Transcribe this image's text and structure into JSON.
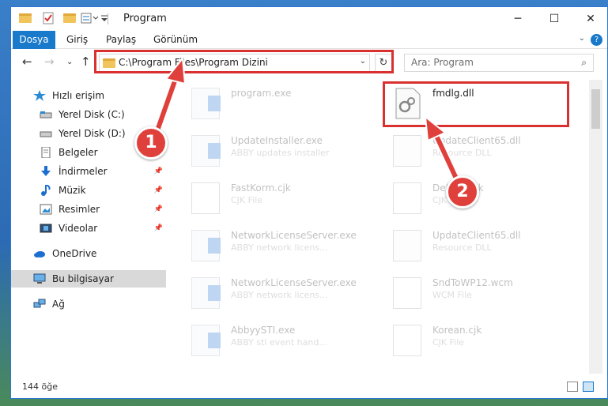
{
  "window": {
    "title": "Program",
    "minimize_label": "─",
    "maximize_label": "☐",
    "close_label": "✕"
  },
  "ribbon": {
    "tabs": [
      "Dosya",
      "Giriş",
      "Paylaş",
      "Görünüm"
    ],
    "help_label": "?",
    "expand_label": "⌄"
  },
  "navigation": {
    "back": "←",
    "forward": "→",
    "recent": "⌄",
    "up": "↑",
    "address": "C:\\Program Files\\Program Dizini",
    "address_dropdown": "⌄",
    "refresh": "↻",
    "search_placeholder": "Ara: Program",
    "search_icon": "⌕"
  },
  "sidebar": {
    "items": [
      {
        "label": "Hızlı erişim",
        "icon": "star-icon"
      },
      {
        "label": "Yerel Disk (C:)",
        "icon": "drive-icon"
      },
      {
        "label": "Yerel Disk (D:)",
        "icon": "drive-icon"
      },
      {
        "label": "Belgeler",
        "icon": "documents-icon"
      },
      {
        "label": "İndirmeler",
        "icon": "download-icon"
      },
      {
        "label": "Müzik",
        "icon": "music-icon"
      },
      {
        "label": "Resimler",
        "icon": "pictures-icon"
      },
      {
        "label": "Videolar",
        "icon": "videos-icon"
      },
      {
        "label": "OneDrive",
        "icon": "cloud-icon"
      },
      {
        "label": "Bu bilgisayar",
        "icon": "computer-icon"
      },
      {
        "label": "Ağ",
        "icon": "network-icon"
      }
    ],
    "pin_glyph": "📌"
  },
  "files": [
    {
      "name": "program.exe",
      "desc": "",
      "type": "exe"
    },
    {
      "name": "fmdlg.dll",
      "desc": "",
      "type": "dll"
    },
    {
      "name": "UpdateInstaller.exe",
      "desc": "ABBY updates installer",
      "type": "exe"
    },
    {
      "name": "UpdateClient65.dll",
      "desc": "Resource DLL",
      "type": "dll"
    },
    {
      "name": "FastKorm.cjk",
      "desc": "CJK File",
      "type": "doc"
    },
    {
      "name": "Default.cjk",
      "desc": "CJK File",
      "type": "doc"
    },
    {
      "name": "NetworkLicenseServer.exe",
      "desc": "ABBY network licens...",
      "type": "exe"
    },
    {
      "name": "UpdateClient65.dll",
      "desc": "Resource DLL",
      "type": "dll"
    },
    {
      "name": "NetworkLicenseServer.exe",
      "desc": "ABBY network licens...",
      "type": "exe"
    },
    {
      "name": "SndToWP12.wcm",
      "desc": "WCM File",
      "type": "doc"
    },
    {
      "name": "AbbyySTI.exe",
      "desc": "ABBY sti event hand...",
      "type": "exe"
    },
    {
      "name": "Korean.cjk",
      "desc": "CJK File",
      "type": "doc"
    }
  ],
  "status": {
    "count": "144 öğe"
  },
  "annotations": {
    "step1": "1",
    "step2": "2"
  },
  "colors": {
    "accent": "#1979ca",
    "highlight": "#d8312f"
  }
}
